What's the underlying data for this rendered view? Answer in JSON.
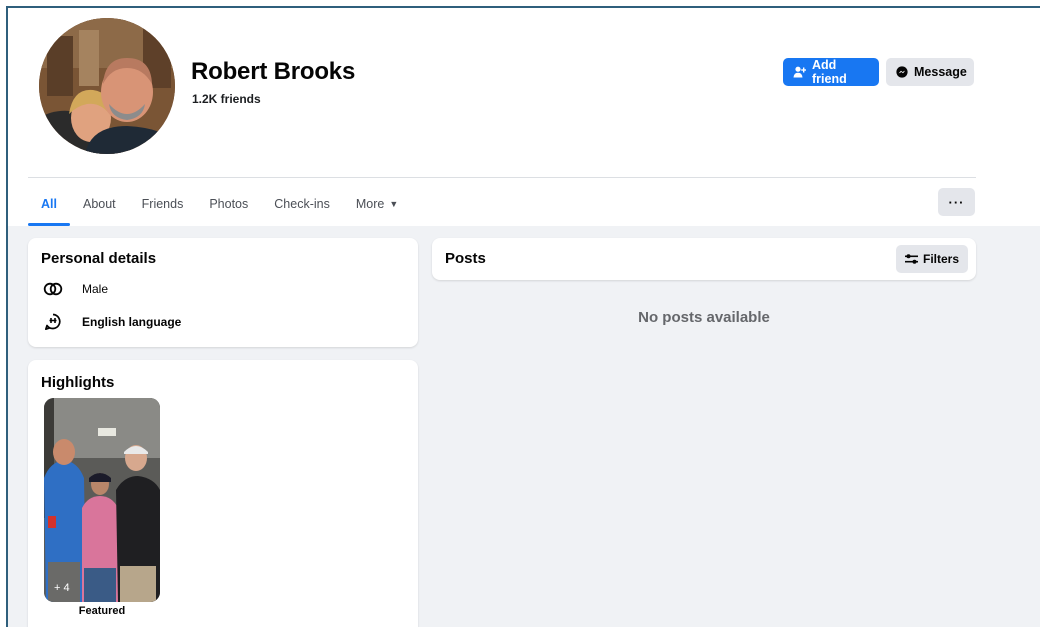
{
  "profile": {
    "name": "Robert Brooks",
    "friends_count": "1.2K friends"
  },
  "actions": {
    "add_friend_label": "Add friend",
    "message_label": "Message",
    "more_label": "···"
  },
  "tabs": [
    {
      "label": "All",
      "active": true
    },
    {
      "label": "About"
    },
    {
      "label": "Friends"
    },
    {
      "label": "Photos"
    },
    {
      "label": "Check-ins"
    },
    {
      "label": "More"
    }
  ],
  "personal_details": {
    "title": "Personal details",
    "items": [
      {
        "icon": "gender-icon",
        "label": "Male"
      },
      {
        "icon": "language-icon",
        "label": "English language"
      }
    ]
  },
  "highlights": {
    "title": "Highlights",
    "items": [
      {
        "caption": "Featured",
        "count": "+ 4"
      }
    ]
  },
  "posts": {
    "title": "Posts",
    "filters_label": "Filters",
    "empty_text": "No posts available"
  },
  "colors": {
    "accent": "#1877f2",
    "page_bg": "#f0f2f5",
    "button_gray": "#e4e6eb"
  }
}
